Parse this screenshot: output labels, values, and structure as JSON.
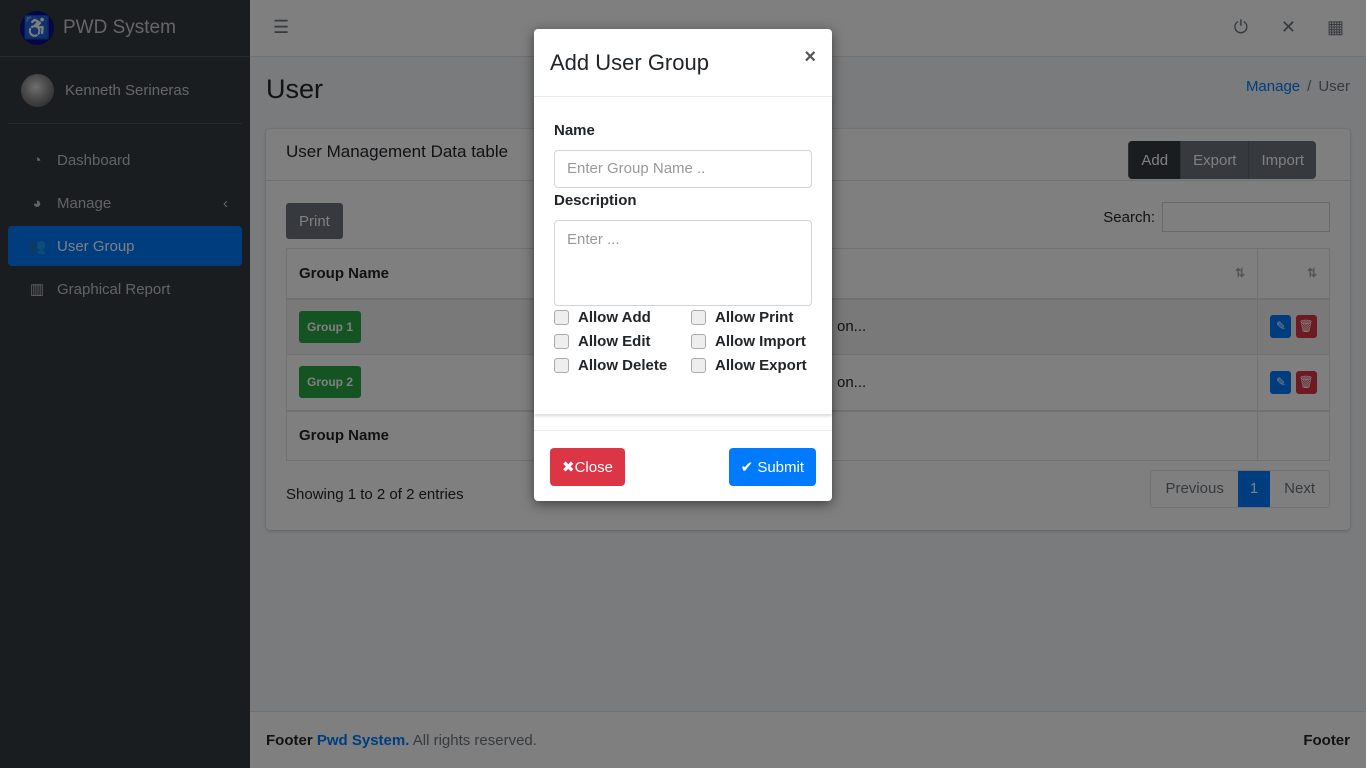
{
  "sidebar": {
    "brand": "PWD System",
    "user": "Kenneth Serineras",
    "items": [
      {
        "label": "Dashboard",
        "icon": "dashboard-icon"
      },
      {
        "label": "Manage",
        "icon": "pie-chart-icon"
      },
      {
        "label": "User Group",
        "icon": "users-icon",
        "active": true
      },
      {
        "label": "Graphical Report",
        "icon": "bar-chart-icon"
      }
    ]
  },
  "page": {
    "title": "User",
    "breadcrumb": [
      "Manage",
      "User"
    ]
  },
  "card": {
    "title": "User Management Data table",
    "add": "Add",
    "export": "Export",
    "import": "Import",
    "print": "Print",
    "search_label": "Search:",
    "search_value": ""
  },
  "table": {
    "header": "Group Name",
    "footer": "Group Name",
    "rows": [
      {
        "group": "Group 1",
        "desc": "on..."
      },
      {
        "group": "Group 2",
        "desc": "on..."
      }
    ]
  },
  "pagination": {
    "info": "Showing 1 to 2 of 2 entries",
    "previous": "Previous",
    "page": "1",
    "next": "Next"
  },
  "footer": {
    "prefix": "Footer",
    "brand": "Pwd System.",
    "suffix": "All rights reserved.",
    "right": "Footer"
  },
  "modal": {
    "title": "Add User Group",
    "close_x": "×",
    "name_label": "Name",
    "name_placeholder": "Enter Group Name ..",
    "desc_label": "Description",
    "desc_placeholder": "Enter ...",
    "checks": [
      "Allow Add",
      "Allow Print",
      "Allow Edit",
      "Allow Import",
      "Allow Delete",
      "Allow Export"
    ],
    "close": "Close",
    "submit": "Submit"
  },
  "colors": {
    "primary": "#007bff",
    "danger": "#dc3545",
    "success": "#28a745",
    "sidebar": "#343a40"
  }
}
